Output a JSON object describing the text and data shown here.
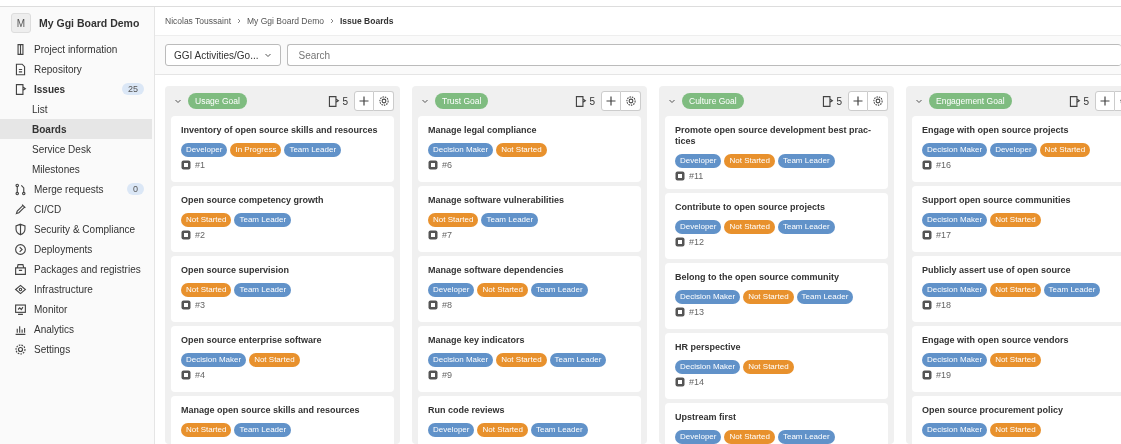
{
  "project": {
    "avatar": "M",
    "name": "My Ggi Board Demo"
  },
  "sidebar": {
    "items": [
      {
        "label": "Project information",
        "selected": false
      },
      {
        "label": "Repository",
        "selected": false
      },
      {
        "label": "Issues",
        "selected": true,
        "count": "25",
        "children": [
          {
            "label": "List",
            "selected": false
          },
          {
            "label": "Boards",
            "selected": true
          },
          {
            "label": "Service Desk",
            "selected": false
          },
          {
            "label": "Milestones",
            "selected": false
          }
        ]
      },
      {
        "label": "Merge requests",
        "selected": false,
        "count": "0"
      },
      {
        "label": "CI/CD",
        "selected": false
      },
      {
        "label": "Security & Compliance",
        "selected": false
      },
      {
        "label": "Deployments",
        "selected": false
      },
      {
        "label": "Packages and registries",
        "selected": false
      },
      {
        "label": "Infrastructure",
        "selected": false
      },
      {
        "label": "Monitor",
        "selected": false
      },
      {
        "label": "Analytics",
        "selected": false
      },
      {
        "label": "Settings",
        "selected": false
      }
    ]
  },
  "breadcrumb": [
    "Nicolas Toussaint",
    "My Ggi Board Demo",
    "Issue Boards"
  ],
  "filter": {
    "board": "GGI Activities/Go...",
    "search_placeholder": "Search"
  },
  "columns": [
    {
      "label": "Usage Goal",
      "count": "5",
      "cards": [
        {
          "title": "Inventory of open source skills and resources",
          "number": "#1",
          "labels": [
            {
              "text": "Developer",
              "color": "#6192c9"
            },
            {
              "text": "In Progress",
              "color": "#e8912d"
            },
            {
              "text": "Team Leader",
              "color": "#6192c9"
            }
          ]
        },
        {
          "title": "Open source competency growth",
          "number": "#2",
          "labels": [
            {
              "text": "Not Started",
              "color": "#e8912d"
            },
            {
              "text": "Team Leader",
              "color": "#6192c9"
            }
          ]
        },
        {
          "title": "Open source supervision",
          "number": "#3",
          "labels": [
            {
              "text": "Not Started",
              "color": "#e8912d"
            },
            {
              "text": "Team Leader",
              "color": "#6192c9"
            }
          ]
        },
        {
          "title": "Open source enterprise software",
          "number": "#4",
          "labels": [
            {
              "text": "Decision Maker",
              "color": "#6192c9"
            },
            {
              "text": "Not Started",
              "color": "#e8912d"
            }
          ]
        },
        {
          "title": "Manage open source skills and resources",
          "labels": [
            {
              "text": "Not Started",
              "color": "#e8912d"
            },
            {
              "text": "Team Leader",
              "color": "#6192c9"
            }
          ]
        }
      ]
    },
    {
      "label": "Trust Goal",
      "count": "5",
      "cards": [
        {
          "title": "Manage legal compliance",
          "number": "#6",
          "labels": [
            {
              "text": "Decision Maker",
              "color": "#6192c9"
            },
            {
              "text": "Not Started",
              "color": "#e8912d"
            }
          ]
        },
        {
          "title": "Manage software vulnerabilities",
          "number": "#7",
          "labels": [
            {
              "text": "Not Started",
              "color": "#e8912d"
            },
            {
              "text": "Team Leader",
              "color": "#6192c9"
            }
          ]
        },
        {
          "title": "Manage software dependencies",
          "number": "#8",
          "labels": [
            {
              "text": "Developer",
              "color": "#6192c9"
            },
            {
              "text": "Not Started",
              "color": "#e8912d"
            },
            {
              "text": "Team Leader",
              "color": "#6192c9"
            }
          ]
        },
        {
          "title": "Manage key indicators",
          "number": "#9",
          "labels": [
            {
              "text": "Decision Maker",
              "color": "#6192c9"
            },
            {
              "text": "Not Started",
              "color": "#e8912d"
            },
            {
              "text": "Team Leader",
              "color": "#6192c9"
            }
          ]
        },
        {
          "title": "Run code reviews",
          "labels": [
            {
              "text": "Developer",
              "color": "#6192c9"
            },
            {
              "text": "Not Started",
              "color": "#e8912d"
            },
            {
              "text": "Team Leader",
              "color": "#6192c9"
            }
          ]
        }
      ]
    },
    {
      "label": "Culture Goal",
      "count": "5",
      "cards": [
        {
          "title": "Promote open source development best prac-tices",
          "number": "#11",
          "labels": [
            {
              "text": "Developer",
              "color": "#6192c9"
            },
            {
              "text": "Not Started",
              "color": "#e8912d"
            },
            {
              "text": "Team Leader",
              "color": "#6192c9"
            }
          ]
        },
        {
          "title": "Contribute to open source projects",
          "number": "#12",
          "labels": [
            {
              "text": "Developer",
              "color": "#6192c9"
            },
            {
              "text": "Not Started",
              "color": "#e8912d"
            },
            {
              "text": "Team Leader",
              "color": "#6192c9"
            }
          ]
        },
        {
          "title": "Belong to the open source community",
          "number": "#13",
          "labels": [
            {
              "text": "Decision Maker",
              "color": "#6192c9"
            },
            {
              "text": "Not Started",
              "color": "#e8912d"
            },
            {
              "text": "Team Leader",
              "color": "#6192c9"
            }
          ]
        },
        {
          "title": "HR perspective",
          "number": "#14",
          "labels": [
            {
              "text": "Decision Maker",
              "color": "#6192c9"
            },
            {
              "text": "Not Started",
              "color": "#e8912d"
            }
          ]
        },
        {
          "title": "Upstream first",
          "labels": [
            {
              "text": "Developer",
              "color": "#6192c9"
            },
            {
              "text": "Not Started",
              "color": "#e8912d"
            },
            {
              "text": "Team Leader",
              "color": "#6192c9"
            }
          ]
        }
      ]
    },
    {
      "label": "Engagement Goal",
      "count": "5",
      "cards": [
        {
          "title": "Engage with open source projects",
          "number": "#16",
          "labels": [
            {
              "text": "Decision Maker",
              "color": "#6192c9"
            },
            {
              "text": "Developer",
              "color": "#6192c9"
            },
            {
              "text": "Not Started",
              "color": "#e8912d"
            }
          ]
        },
        {
          "title": "Support open source communities",
          "number": "#17",
          "labels": [
            {
              "text": "Decision Maker",
              "color": "#6192c9"
            },
            {
              "text": "Not Started",
              "color": "#e8912d"
            }
          ]
        },
        {
          "title": "Publicly assert use of open source",
          "number": "#18",
          "labels": [
            {
              "text": "Decision Maker",
              "color": "#6192c9"
            },
            {
              "text": "Not Started",
              "color": "#e8912d"
            },
            {
              "text": "Team Leader",
              "color": "#6192c9"
            }
          ]
        },
        {
          "title": "Engage with open source vendors",
          "number": "#19",
          "labels": [
            {
              "text": "Decision Maker",
              "color": "#6192c9"
            },
            {
              "text": "Not Started",
              "color": "#e8912d"
            }
          ]
        },
        {
          "title": "Open source procurement policy",
          "labels": [
            {
              "text": "Decision Maker",
              "color": "#6192c9"
            },
            {
              "text": "Not Started",
              "color": "#e8912d"
            }
          ]
        }
      ]
    }
  ]
}
